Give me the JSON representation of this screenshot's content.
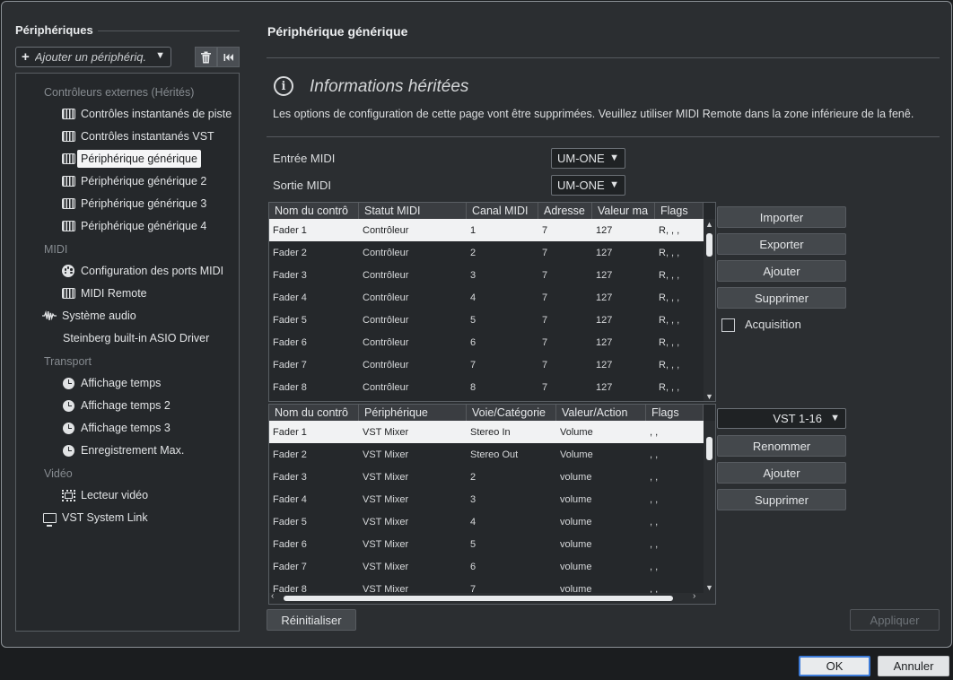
{
  "sidebar": {
    "title": "Périphériques",
    "add_device_label": "Ajouter un périphériq.",
    "categories": {
      "external": "Contrôleurs externes (Hérités)",
      "midi": "MIDI",
      "transport": "Transport",
      "video": "Vidéo"
    },
    "items": {
      "track_quick_controls": "Contrôles instantanés de piste",
      "vst_quick_controls": "Contrôles instantanés VST",
      "generic_device": "Périphérique générique",
      "generic_device_2": "Périphérique générique 2",
      "generic_device_3": "Périphérique générique 3",
      "generic_device_4": "Périphérique générique 4",
      "midi_port_setup": "Configuration des ports MIDI",
      "midi_remote": "MIDI Remote",
      "audio_system": "Système audio",
      "asio_driver": "Steinberg built-in ASIO Driver",
      "time_display": "Affichage temps",
      "time_display_2": "Affichage temps 2",
      "time_display_3": "Affichage temps 3",
      "max_recording": "Enregistrement Max.",
      "video_player": "Lecteur vidéo",
      "vst_system_link": "VST System Link"
    }
  },
  "main": {
    "title": "Périphérique générique",
    "info_title": "Informations héritées",
    "info_text": "Les options de configuration de cette page vont être supprimées. Veuillez utiliser MIDI Remote dans la zone inférieure de la fenê.",
    "midi_input_label": "Entrée MIDI",
    "midi_input_value": "UM-ONE",
    "midi_output_label": "Sortie MIDI",
    "midi_output_value": "UM-ONE",
    "controller_table": {
      "headers": [
        "Nom du contrô",
        "Statut MIDI",
        "Canal MIDI",
        "Adresse",
        "Valeur ma",
        "Flags"
      ],
      "rows": [
        [
          "Fader 1",
          "Contrôleur",
          "1",
          "7",
          "127",
          "R, , ,"
        ],
        [
          "Fader 2",
          "Contrôleur",
          "2",
          "7",
          "127",
          "R, , ,"
        ],
        [
          "Fader 3",
          "Contrôleur",
          "3",
          "7",
          "127",
          "R, , ,"
        ],
        [
          "Fader 4",
          "Contrôleur",
          "4",
          "7",
          "127",
          "R, , ,"
        ],
        [
          "Fader 5",
          "Contrôleur",
          "5",
          "7",
          "127",
          "R, , ,"
        ],
        [
          "Fader 6",
          "Contrôleur",
          "6",
          "7",
          "127",
          "R, , ,"
        ],
        [
          "Fader 7",
          "Contrôleur",
          "7",
          "7",
          "127",
          "R, , ,"
        ],
        [
          "Fader 8",
          "Contrôleur",
          "8",
          "7",
          "127",
          "R, , ,"
        ]
      ]
    },
    "bank_table": {
      "headers": [
        "Nom du contrô",
        "Périphérique",
        "Voie/Catégorie",
        "Valeur/Action",
        "Flags"
      ],
      "rows": [
        [
          "Fader 1",
          "VST Mixer",
          "Stereo In",
          "Volume",
          ", ,"
        ],
        [
          "Fader 2",
          "VST Mixer",
          "Stereo Out",
          "Volume",
          ", ,"
        ],
        [
          "Fader 3",
          "VST Mixer",
          "2",
          "volume",
          ", ,"
        ],
        [
          "Fader 4",
          "VST Mixer",
          "3",
          "volume",
          ", ,"
        ],
        [
          "Fader 5",
          "VST Mixer",
          "4",
          "volume",
          ", ,"
        ],
        [
          "Fader 6",
          "VST Mixer",
          "5",
          "volume",
          ", ,"
        ],
        [
          "Fader 7",
          "VST Mixer",
          "6",
          "volume",
          ", ,"
        ],
        [
          "Fader 8",
          "VST Mixer",
          "7",
          "volume",
          ", ,"
        ]
      ]
    },
    "buttons": {
      "import": "Importer",
      "export": "Exporter",
      "add": "Ajouter",
      "delete": "Supprimer",
      "acquisition": "Acquisition",
      "bank_value": "VST 1-16",
      "rename": "Renommer",
      "add2": "Ajouter",
      "delete2": "Supprimer",
      "reset": "Réinitialiser",
      "apply": "Appliquer"
    }
  },
  "footer": {
    "ok": "OK",
    "cancel": "Annuler"
  },
  "icons": {
    "add": "plus-icon",
    "trash": "trash-icon",
    "reset": "skip-back-icon",
    "info": "info-icon"
  }
}
